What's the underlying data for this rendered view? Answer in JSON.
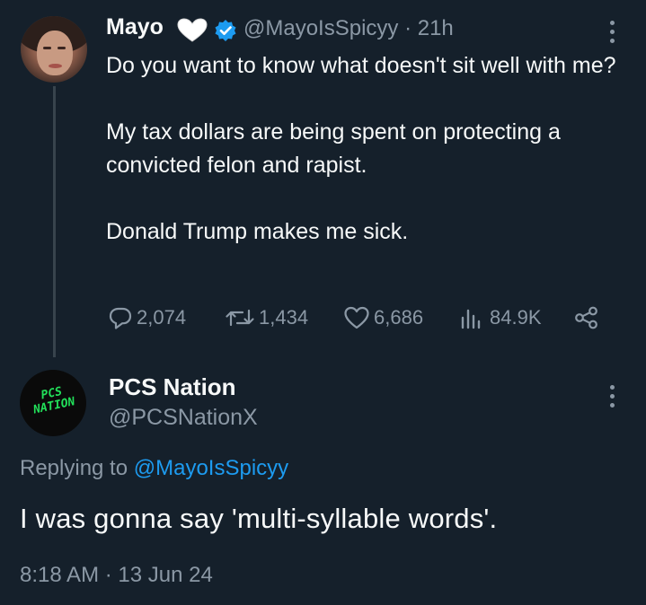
{
  "tweet": {
    "author_name": "Mayo",
    "author_handle": "@MayoIsSpicyy · 21h",
    "text": "Do you want to know what doesn't sit well with me?\n\nMy tax dollars are being spent on protecting a convicted felon and rapist.\n\nDonald Trump makes me sick.",
    "stats": {
      "replies": "2,074",
      "retweets": "1,434",
      "likes": "6,686",
      "views": "84.9K"
    }
  },
  "reply": {
    "author_name": "PCS Nation",
    "author_handle": "@PCSNationX",
    "avatar_text": "PCS NATION",
    "replying_prefix": "Replying to",
    "replying_mention": "@MayoIsSpicyy",
    "text": "I was gonna say 'multi-syllable words'.",
    "timestamp": "8:18 AM · 13 Jun 24"
  },
  "icons": [
    "heart-emoji-icon",
    "verified-badge-icon",
    "more-options-icon",
    "reply-icon",
    "retweet-icon",
    "like-icon",
    "views-icon",
    "share-icon"
  ],
  "colors": {
    "background": "#15202b",
    "text": "#f7f9f9",
    "muted": "#8b98a5",
    "accent": "#1d9bf0",
    "logo_green": "#22e05a"
  }
}
